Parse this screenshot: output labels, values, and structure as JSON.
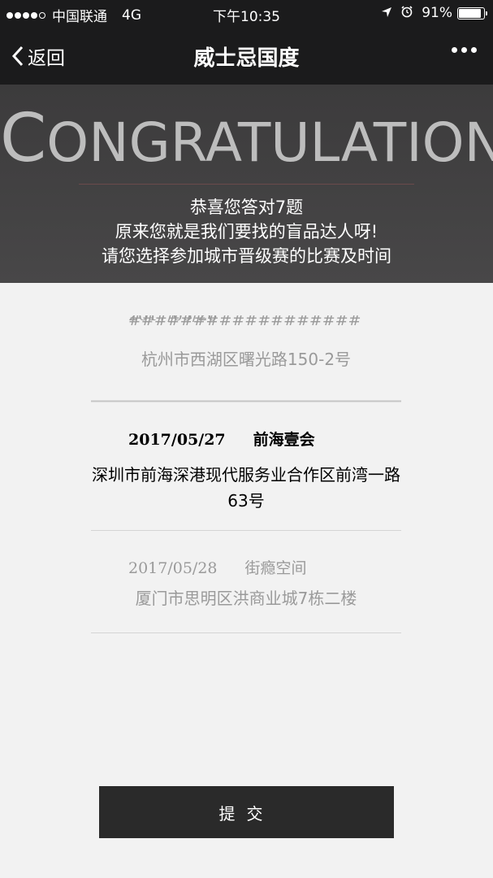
{
  "status_bar": {
    "carrier": "中国联通",
    "network": "4G",
    "time": "下午10:35",
    "battery_percent": "91%",
    "battery_level": 0.91
  },
  "nav": {
    "back_label": "返回",
    "title": "威士忌国度"
  },
  "header": {
    "congrats_first": "C",
    "congrats_rest": "ONGRATULATION",
    "line1": "恭喜您答对7题",
    "line2": "原来您就是我们要找的盲品达人呀!",
    "line3": "请您选择参加城市晋级赛的比赛及时间"
  },
  "events": [
    {
      "date": "2017/05/26",
      "venue": "##################",
      "address": "杭州市西湖区曙光路150-2号",
      "selected": false
    },
    {
      "date": "2017/05/27",
      "venue": "前海壹会",
      "address": "深圳市前海深港现代服务业合作区前湾一路63号",
      "selected": true
    },
    {
      "date": "2017/05/28",
      "venue": "街瘾空间",
      "address": "厦门市思明区洪商业城7栋二楼",
      "selected": false
    }
  ],
  "submit_label": "提交"
}
